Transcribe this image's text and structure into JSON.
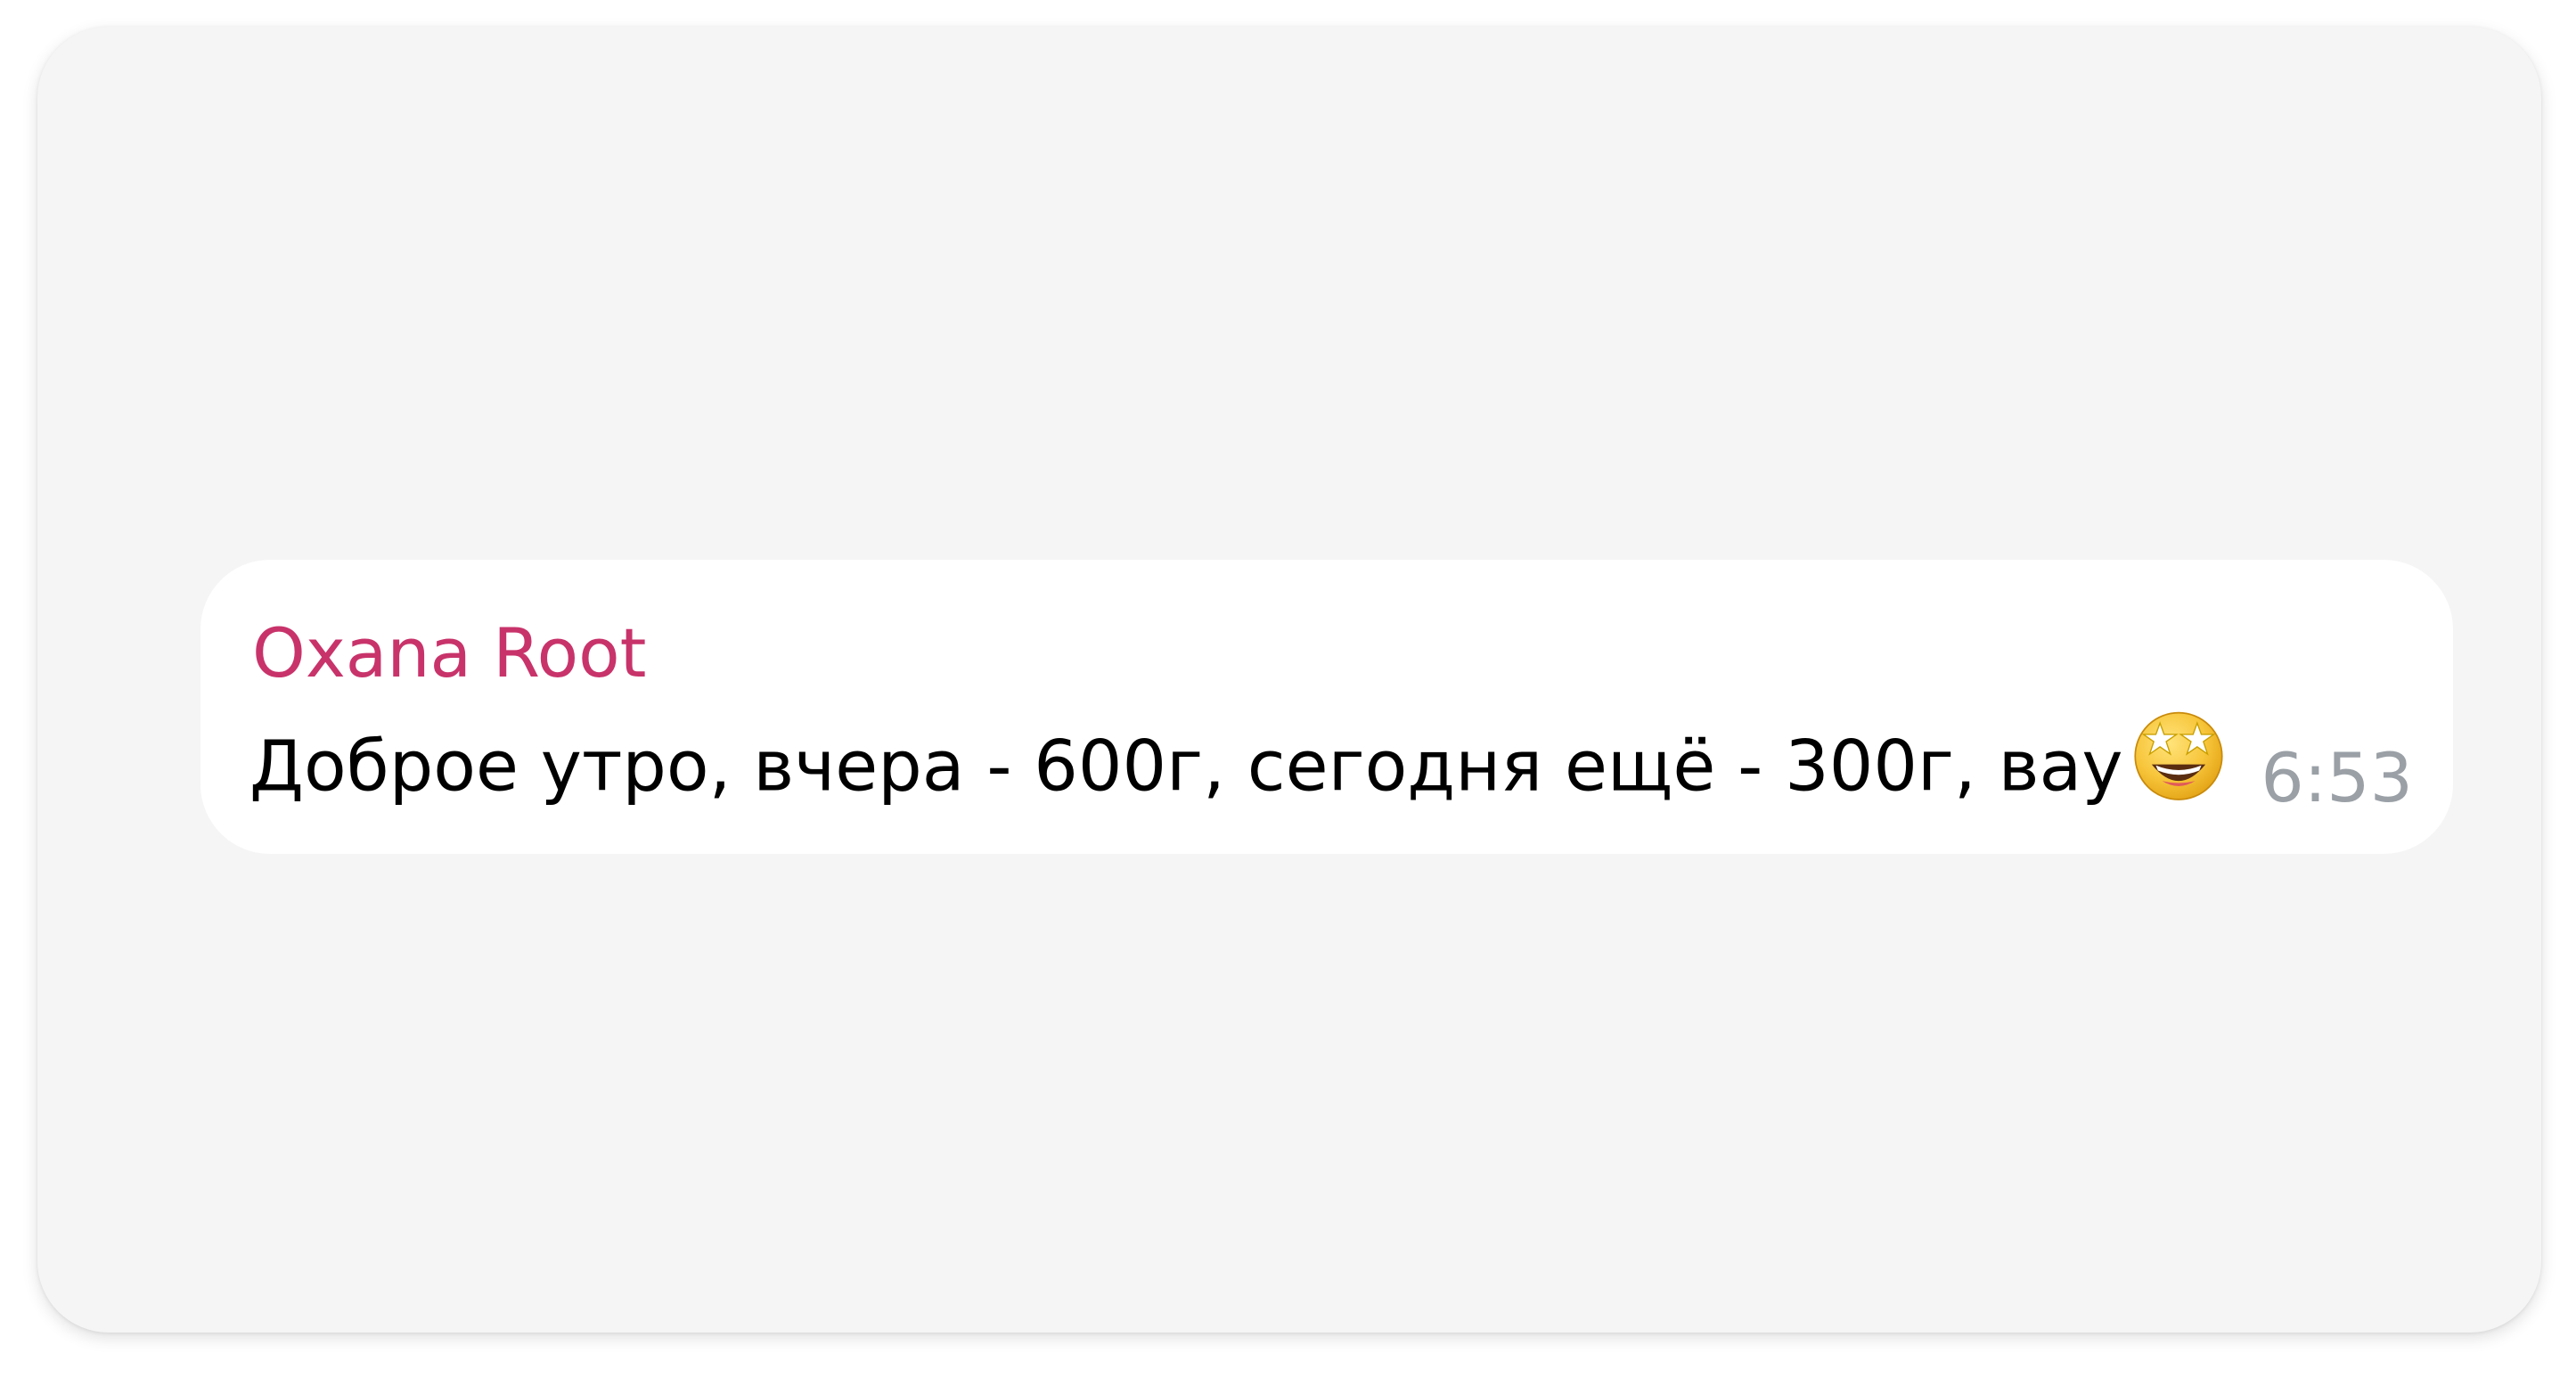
{
  "message": {
    "sender_name": "Oxana Root",
    "sender_color": "#c8336a",
    "text": "Доброе утро, вчера - 600г, сегодня ещё - 300г, вау",
    "emoji": "star-struck-emoji",
    "time": "6:53"
  },
  "colors": {
    "card_background": "#f5f5f5",
    "bubble_background": "#ffffff",
    "time_color": "#9aa0a6"
  }
}
